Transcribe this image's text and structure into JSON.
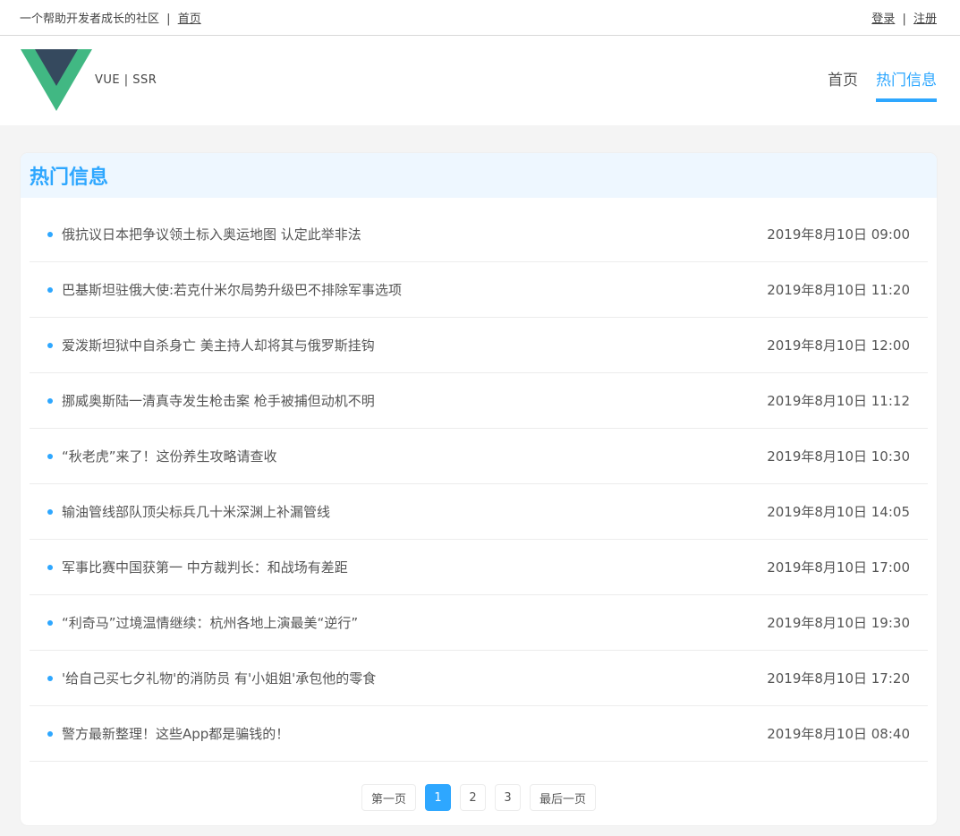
{
  "topbar": {
    "tagline": "一个帮助开发者成长的社区",
    "separator": "|",
    "home_link": "首页",
    "login": "登录",
    "register": "注册"
  },
  "header": {
    "logo_text": "VUE | SSR",
    "nav": [
      {
        "label": "首页",
        "active": false
      },
      {
        "label": "热门信息",
        "active": true
      }
    ]
  },
  "colors": {
    "accent": "#2ea7ff",
    "logo_green": "#41b883",
    "logo_dark": "#35495e"
  },
  "main": {
    "section_title": "热门信息",
    "news": [
      {
        "title": "俄抗议日本把争议领土标入奥运地图 认定此举非法",
        "time": "2019年8月10日 09:00"
      },
      {
        "title": "巴基斯坦驻俄大使:若克什米尔局势升级巴不排除军事选项",
        "time": "2019年8月10日 11:20"
      },
      {
        "title": "爱泼斯坦狱中自杀身亡 美主持人却将其与俄罗斯挂钩",
        "time": "2019年8月10日 12:00"
      },
      {
        "title": "挪威奥斯陆一清真寺发生枪击案 枪手被捕但动机不明",
        "time": "2019年8月10日 11:12"
      },
      {
        "title": "“秋老虎”来了！这份养生攻略请查收",
        "time": "2019年8月10日 10:30"
      },
      {
        "title": "输油管线部队顶尖标兵几十米深渊上补漏管线",
        "time": "2019年8月10日 14:05"
      },
      {
        "title": "军事比赛中国获第一 中方裁判长：和战场有差距",
        "time": "2019年8月10日 17:00"
      },
      {
        "title": "“利奇马”过境温情继续：杭州各地上演最美“逆行”",
        "time": "2019年8月10日 19:30"
      },
      {
        "title": "'给自己买七夕礼物'的消防员 有'小姐姐'承包他的零食",
        "time": "2019年8月10日 17:20"
      },
      {
        "title": "警方最新整理！这些App都是骗钱的！",
        "time": "2019年8月10日 08:40"
      }
    ]
  },
  "pagination": {
    "first": "第一页",
    "pages": [
      "1",
      "2",
      "3"
    ],
    "current": "1",
    "last": "最后一页"
  }
}
